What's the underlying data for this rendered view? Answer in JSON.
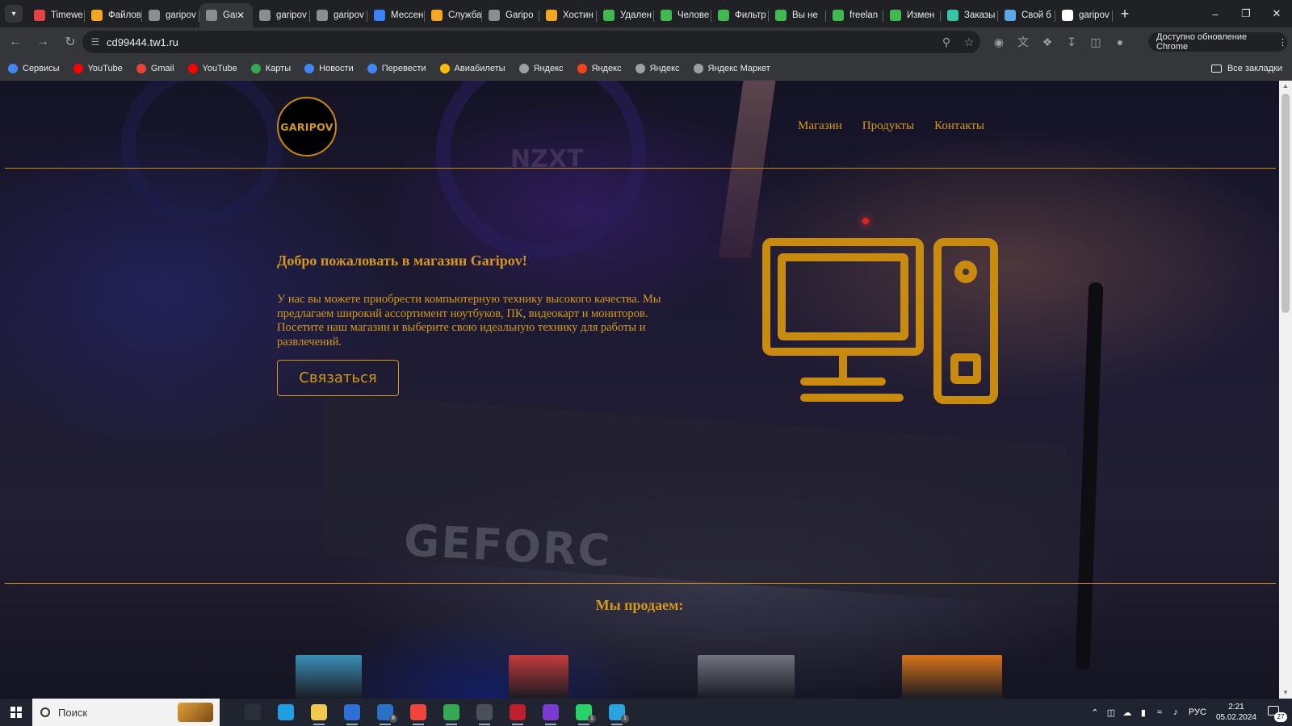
{
  "browser": {
    "tabs": [
      {
        "title": "Timewe",
        "icon": "timeweb-icon",
        "color": "#e04545"
      },
      {
        "title": "Файлов",
        "icon": "chevron-icon",
        "color": "#f5a623"
      },
      {
        "title": "garipov",
        "icon": "globe-icon",
        "color": "#8a8d91"
      },
      {
        "title": "Gar",
        "icon": "globe-icon",
        "color": "#8a8d91"
      },
      {
        "title": "garipov",
        "icon": "globe-icon",
        "color": "#8a8d91"
      },
      {
        "title": "garipov",
        "icon": "globe-icon",
        "color": "#8a8d91"
      },
      {
        "title": "Мессен",
        "icon": "messenger-icon",
        "color": "#3b82f6"
      },
      {
        "title": "Служба",
        "icon": "chevron-icon",
        "color": "#f5a623"
      },
      {
        "title": "Garipo",
        "icon": "globe-icon",
        "color": "#8a8d91"
      },
      {
        "title": "Хостин",
        "icon": "chevron-icon",
        "color": "#f5a623"
      },
      {
        "title": "Удален",
        "icon": "fl-icon",
        "color": "#3fb950"
      },
      {
        "title": "Челове",
        "icon": "fl-icon",
        "color": "#3fb950"
      },
      {
        "title": "Фильтр",
        "icon": "freelance-icon",
        "color": "#3fb950"
      },
      {
        "title": "Вы не",
        "icon": "freelance-icon",
        "color": "#3fb950"
      },
      {
        "title": "freelan",
        "icon": "freelance-icon",
        "color": "#3fb950"
      },
      {
        "title": "Измен",
        "icon": "freelance-icon",
        "color": "#3fb950"
      },
      {
        "title": "Заказы",
        "icon": "kwork-icon",
        "color": "#34c7a5"
      },
      {
        "title": "Свой б",
        "icon": "kwork-icon",
        "color": "#5aa9e6"
      },
      {
        "title": "garipov",
        "icon": "google-icon",
        "color": "#ffffff"
      }
    ],
    "active_tab_index": 3,
    "url": "cd99444.tw1.ru",
    "update_label": "Доступно обновление Chrome",
    "bookmarks": [
      {
        "label": "Сервисы",
        "icon": "apps-grid-icon",
        "color": "#4285f4"
      },
      {
        "label": "YouTube",
        "icon": "youtube-icon",
        "color": "#ff0000"
      },
      {
        "label": "Gmail",
        "icon": "gmail-icon",
        "color": "#ea4335"
      },
      {
        "label": "YouTube",
        "icon": "youtube-icon",
        "color": "#ff0000"
      },
      {
        "label": "Карты",
        "icon": "maps-icon",
        "color": "#34a853"
      },
      {
        "label": "Новости",
        "icon": "news-icon",
        "color": "#4285f4"
      },
      {
        "label": "Перевести",
        "icon": "translate-icon",
        "color": "#4285f4"
      },
      {
        "label": "Авиабилеты",
        "icon": "flights-icon",
        "color": "#fbbc05"
      },
      {
        "label": "Яндекс",
        "icon": "globe-icon",
        "color": "#9aa0a6"
      },
      {
        "label": "Яндекс",
        "icon": "yandex-icon",
        "color": "#fc3f1d"
      },
      {
        "label": "Яндекс",
        "icon": "globe-icon",
        "color": "#9aa0a6"
      },
      {
        "label": "Яндекс Маркет",
        "icon": "globe-icon",
        "color": "#9aa0a6"
      }
    ],
    "all_bookmarks_label": "Все закладки"
  },
  "site": {
    "logo_text": "GARIPOV",
    "nav": [
      "Магазин",
      "Продукты",
      "Контакты"
    ],
    "hero_title": "Добро пожаловать в магазин Garipov!",
    "hero_text": "У нас вы можете приобрести компьютерную технику высокого качества. Мы предлагаем широкий ассортимент ноутбуков, ПК, видеокарт и мониторов. Посетите наш магазин и выберите свою идеальную технику для работы и развлечений.",
    "contact_button": "Связаться",
    "sells_title": "Мы продаем:",
    "accent_color": "#d4991c",
    "products": [
      {
        "icon": "laptop-image",
        "color": "#3a8fb8"
      },
      {
        "icon": "pc-case-image",
        "color": "#c23b3b"
      },
      {
        "icon": "graphics-card-image",
        "color": "#6f7480"
      },
      {
        "icon": "monitor-image",
        "color": "#d9731a"
      }
    ]
  },
  "taskbar": {
    "search_placeholder": "Поиск",
    "apps": [
      {
        "icon": "task-view-icon",
        "color": "#2b2f3a",
        "badge": ""
      },
      {
        "icon": "edge-icon",
        "color": "#1f9ee0",
        "badge": ""
      },
      {
        "icon": "file-explorer-icon",
        "color": "#f2c94c",
        "badge": ""
      },
      {
        "icon": "ms-store-icon",
        "color": "#2f6fd6",
        "badge": ""
      },
      {
        "icon": "mail-icon",
        "color": "#2a72c9",
        "badge": "8"
      },
      {
        "icon": "yandex-browser-icon",
        "color": "#f0453a",
        "badge": ""
      },
      {
        "icon": "chrome-icon",
        "color": "#34a853",
        "badge": ""
      },
      {
        "icon": "settings-icon",
        "color": "#4a4f5a",
        "badge": ""
      },
      {
        "icon": "filezilla-icon",
        "color": "#bf1e2d",
        "badge": ""
      },
      {
        "icon": "figma-icon",
        "color": "#7a3bd1",
        "badge": ""
      },
      {
        "icon": "whatsapp-icon",
        "color": "#25d366",
        "badge": "1"
      },
      {
        "icon": "telegram-icon",
        "color": "#2aa3df",
        "badge": "1"
      }
    ],
    "language": "РУС",
    "time": "2:21",
    "date": "05.02.2024",
    "notifications": "27"
  }
}
